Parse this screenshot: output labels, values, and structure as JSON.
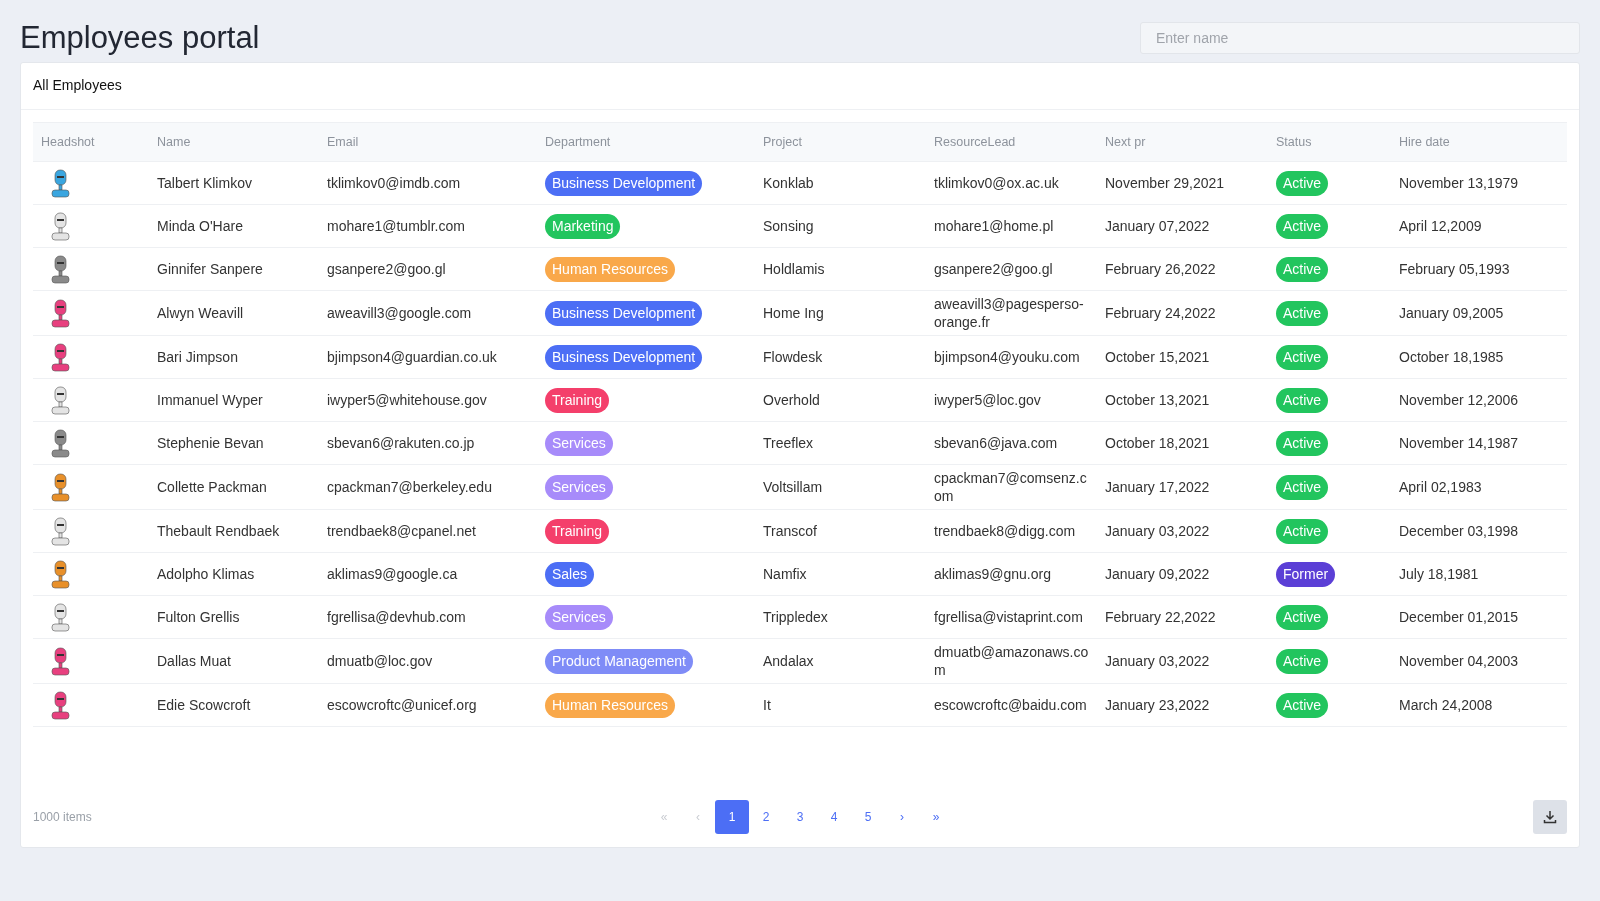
{
  "title": "Employees portal",
  "search": {
    "placeholder": "Enter name"
  },
  "card_title": "All Employees",
  "table": {
    "columns": [
      "Headshot",
      "Name",
      "Email",
      "Department",
      "Project",
      "ResourceLead",
      "Next pr",
      "Status",
      "Hire date"
    ],
    "rows": [
      {
        "headshot": {
          "color": "#3aa6e0"
        },
        "name": "Talbert Klimkov",
        "email": "tklimkov0@imdb.com",
        "department": {
          "label": "Business Development",
          "color": "#4c6ef5"
        },
        "project": "Konklab",
        "resource_lead": "tklimkov0@ox.ac.uk",
        "next_pr": "November 29,2021",
        "status": {
          "label": "Active",
          "color": "#22c55e"
        },
        "hire_date": "November 13,1979"
      },
      {
        "headshot": {
          "color": "#e4e4e4"
        },
        "name": "Minda O'Hare",
        "email": "mohare1@tumblr.com",
        "department": {
          "label": "Marketing",
          "color": "#22c55e"
        },
        "project": "Sonsing",
        "resource_lead": "mohare1@home.pl",
        "next_pr": "January 07,2022",
        "status": {
          "label": "Active",
          "color": "#22c55e"
        },
        "hire_date": "April 12,2009"
      },
      {
        "headshot": {
          "color": "#8a8a8a"
        },
        "name": "Ginnifer Sanpere",
        "email": "gsanpere2@goo.gl",
        "department": {
          "label": "Human Resources",
          "color": "#f9a84a"
        },
        "project": "Holdlamis",
        "resource_lead": "gsanpere2@goo.gl",
        "next_pr": "February 26,2022",
        "status": {
          "label": "Active",
          "color": "#22c55e"
        },
        "hire_date": "February 05,1993"
      },
      {
        "headshot": {
          "color": "#e8407f"
        },
        "name": "Alwyn Weavill",
        "email": "aweavill3@google.com",
        "department": {
          "label": "Business Development",
          "color": "#4c6ef5"
        },
        "project": "Home Ing",
        "resource_lead": "aweavill3@pagesperso-orange.fr",
        "next_pr": "February 24,2022",
        "status": {
          "label": "Active",
          "color": "#22c55e"
        },
        "hire_date": "January 09,2005"
      },
      {
        "headshot": {
          "color": "#e8407f"
        },
        "name": "Bari Jimpson",
        "email": "bjimpson4@guardian.co.uk",
        "department": {
          "label": "Business Development",
          "color": "#4c6ef5"
        },
        "project": "Flowdesk",
        "resource_lead": "bjimpson4@youku.com",
        "next_pr": "October 15,2021",
        "status": {
          "label": "Active",
          "color": "#22c55e"
        },
        "hire_date": "October 18,1985"
      },
      {
        "headshot": {
          "color": "#e4e4e4"
        },
        "name": "Immanuel Wyper",
        "email": "iwyper5@whitehouse.gov",
        "department": {
          "label": "Training",
          "color": "#f43f6b"
        },
        "project": "Overhold",
        "resource_lead": "iwyper5@loc.gov",
        "next_pr": "October 13,2021",
        "status": {
          "label": "Active",
          "color": "#22c55e"
        },
        "hire_date": "November 12,2006"
      },
      {
        "headshot": {
          "color": "#8a8a8a"
        },
        "name": "Stephenie Bevan",
        "email": "sbevan6@rakuten.co.jp",
        "department": {
          "label": "Services",
          "color": "#a78bfa"
        },
        "project": "Treeflex",
        "resource_lead": "sbevan6@java.com",
        "next_pr": "October 18,2021",
        "status": {
          "label": "Active",
          "color": "#22c55e"
        },
        "hire_date": "November 14,1987"
      },
      {
        "headshot": {
          "color": "#e8902a"
        },
        "name": "Collette Packman",
        "email": "cpackman7@berkeley.edu",
        "department": {
          "label": "Services",
          "color": "#a78bfa"
        },
        "project": "Voltsillam",
        "resource_lead": "cpackman7@comsenz.com",
        "next_pr": "January 17,2022",
        "status": {
          "label": "Active",
          "color": "#22c55e"
        },
        "hire_date": "April 02,1983"
      },
      {
        "headshot": {
          "color": "#e4e4e4"
        },
        "name": "Thebault Rendbaek",
        "email": "trendbaek8@cpanel.net",
        "department": {
          "label": "Training",
          "color": "#f43f6b"
        },
        "project": "Transcof",
        "resource_lead": "trendbaek8@digg.com",
        "next_pr": "January 03,2022",
        "status": {
          "label": "Active",
          "color": "#22c55e"
        },
        "hire_date": "December 03,1998"
      },
      {
        "headshot": {
          "color": "#e8902a"
        },
        "name": "Adolpho Klimas",
        "email": "aklimas9@google.ca",
        "department": {
          "label": "Sales",
          "color": "#4c6ef5"
        },
        "project": "Namfix",
        "resource_lead": "aklimas9@gnu.org",
        "next_pr": "January 09,2022",
        "status": {
          "label": "Former",
          "color": "#5b3fd6"
        },
        "hire_date": "July 18,1981"
      },
      {
        "headshot": {
          "color": "#e4e4e4"
        },
        "name": "Fulton Grellis",
        "email": "fgrellisa@devhub.com",
        "department": {
          "label": "Services",
          "color": "#a78bfa"
        },
        "project": "Trippledex",
        "resource_lead": "fgrellisa@vistaprint.com",
        "next_pr": "February 22,2022",
        "status": {
          "label": "Active",
          "color": "#22c55e"
        },
        "hire_date": "December 01,2015"
      },
      {
        "headshot": {
          "color": "#e8407f"
        },
        "name": "Dallas Muat",
        "email": "dmuatb@loc.gov",
        "department": {
          "label": "Product Management",
          "color": "#7f8cf7"
        },
        "project": "Andalax",
        "resource_lead": "dmuatb@amazonaws.com",
        "next_pr": "January 03,2022",
        "status": {
          "label": "Active",
          "color": "#22c55e"
        },
        "hire_date": "November 04,2003"
      },
      {
        "headshot": {
          "color": "#e8407f"
        },
        "name": "Edie Scowcroft",
        "email": "escowcroftc@unicef.org",
        "department": {
          "label": "Human Resources",
          "color": "#f9a84a"
        },
        "project": "It",
        "resource_lead": "escowcroftc@baidu.com",
        "next_pr": "January 23,2022",
        "status": {
          "label": "Active",
          "color": "#22c55e"
        },
        "hire_date": "March 24,2008"
      }
    ]
  },
  "footer": {
    "count": "1000 items",
    "pages": [
      {
        "label": "«",
        "selected": false,
        "disabled": true
      },
      {
        "label": "‹",
        "selected": false,
        "disabled": true
      },
      {
        "label": "1",
        "selected": true,
        "disabled": false
      },
      {
        "label": "2",
        "selected": false,
        "disabled": false
      },
      {
        "label": "3",
        "selected": false,
        "disabled": false
      },
      {
        "label": "4",
        "selected": false,
        "disabled": false
      },
      {
        "label": "5",
        "selected": false,
        "disabled": false
      },
      {
        "label": "›",
        "selected": false,
        "disabled": false
      },
      {
        "label": "»",
        "selected": false,
        "disabled": false
      }
    ]
  }
}
